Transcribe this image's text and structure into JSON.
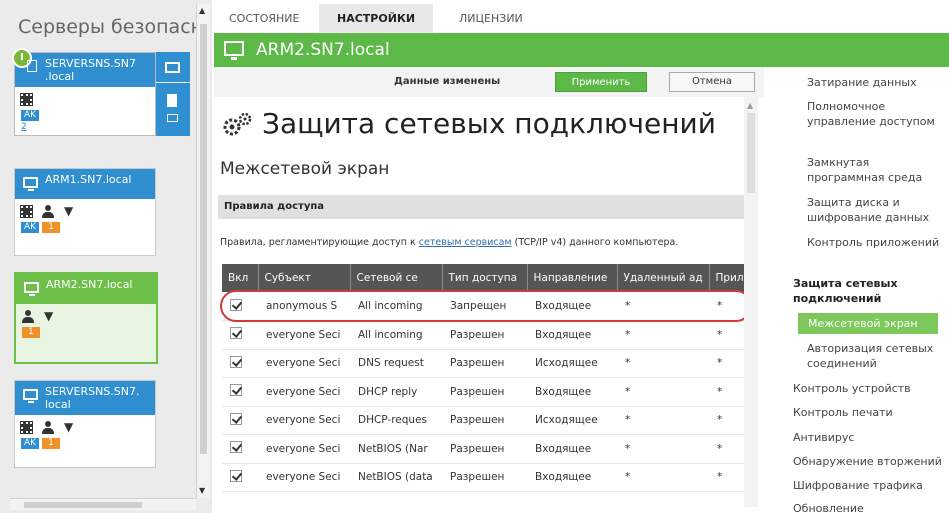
{
  "sidebar": {
    "title": "Серверы безопасн",
    "cards": [
      {
        "name": "SERVERSNS.SN7 .local",
        "badge_ak": "AK",
        "count": "2"
      },
      {
        "name": "ARM1.SN7.local",
        "badge_ak": "AK",
        "badge_num": "1"
      },
      {
        "name": "ARM2.SN7.local",
        "badge_num": "1"
      },
      {
        "name": "SERVERSNS.SN7. local",
        "badge_ak": "AK",
        "badge_num": "1"
      }
    ]
  },
  "tabs": [
    {
      "label": "СОСТОЯНИЕ"
    },
    {
      "label": "НАСТРОЙКИ"
    },
    {
      "label": "ЛИЦЕНЗИИ"
    }
  ],
  "header": {
    "host": "ARM2.SN7.local"
  },
  "action_bar": {
    "status": "Данные изменены",
    "apply": "Применить",
    "cancel": "Отмена"
  },
  "main": {
    "title": "Защита сетевых подключений",
    "subtitle": "Межсетевой экран",
    "section": "Правила доступа",
    "desc_before": "Правила, регламентирующие доступ к ",
    "desc_link": "сетевым сервисам",
    "desc_after": " (TCP/IP v4) данного компьютера.",
    "columns": [
      "Вкл",
      "Субъект",
      "Сетевой се",
      "Тип доступа",
      "Направление",
      "Удаленный ад",
      "Прил"
    ],
    "rows": [
      {
        "subject": "anonymous S",
        "service": "All incoming",
        "access": "Запрещен",
        "direction": "Входящее",
        "remote": "*",
        "app": "*"
      },
      {
        "subject": "everyone Seci",
        "service": "All incoming",
        "access": "Разрешен",
        "direction": "Входящее",
        "remote": "*",
        "app": "*"
      },
      {
        "subject": "everyone Seci",
        "service": "DNS request",
        "access": "Разрешен",
        "direction": "Исходящее",
        "remote": "*",
        "app": "*"
      },
      {
        "subject": "everyone Seci",
        "service": "DHCP reply",
        "access": "Разрешен",
        "direction": "Входящее",
        "remote": "*",
        "app": "*"
      },
      {
        "subject": "everyone Seci",
        "service": "DHCP-reques",
        "access": "Разрешен",
        "direction": "Исходящее",
        "remote": "*",
        "app": "*"
      },
      {
        "subject": "everyone Seci",
        "service": "NetBIOS (Nar",
        "access": "Разрешен",
        "direction": "Входящее",
        "remote": "*",
        "app": "*"
      },
      {
        "subject": "everyone Seci",
        "service": "NetBIOS (data",
        "access": "Разрешен",
        "direction": "Входящее",
        "remote": "*",
        "app": "*"
      }
    ]
  },
  "right_nav": {
    "items": [
      "Затирание данных",
      "Полномочное управление доступом",
      "Замкнутая программная среда",
      "Защита диска и шифрование данных",
      "Контроль приложений",
      "Защита сетевых подключений",
      "Межсетевой экран",
      "Авторизация сетевых соединений",
      "Контроль устройств",
      "Контроль печати",
      "Антивирус",
      "Обнаружение вторжений",
      "Шифрование трафика",
      "Обновление"
    ]
  },
  "colors": {
    "accent_green": "#5cb948",
    "accent_blue": "#2f8fd1",
    "highlight_red": "#d23b3b"
  }
}
